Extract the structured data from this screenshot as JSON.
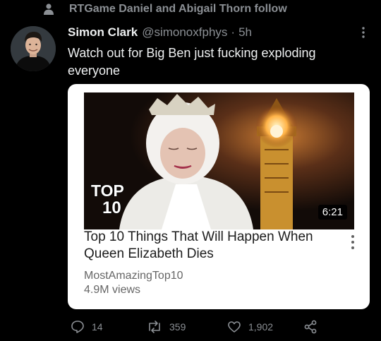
{
  "social_context": {
    "text": "RTGame Daniel and Abigail Thorn follow",
    "icon": "person-icon"
  },
  "tweet": {
    "display_name": "Simon Clark",
    "handle": "@simonoxfphys",
    "separator": "·",
    "timestamp": "5h",
    "text": "Watch out for Big Ben just fucking exploding everyone"
  },
  "card": {
    "thumbnail_badge": {
      "line1": "TOP",
      "line2": "10"
    },
    "duration": "6:21",
    "title": "Top 10 Things That Will Happen When Queen Elizabeth Dies",
    "channel": "MostAmazingTop10",
    "views": "4.9M views"
  },
  "actions": {
    "replies": "14",
    "retweets": "359",
    "likes": "1,902"
  },
  "colors": {
    "background": "#000000",
    "secondary_text": "#8b8f94",
    "card_background": "#ffffff"
  }
}
